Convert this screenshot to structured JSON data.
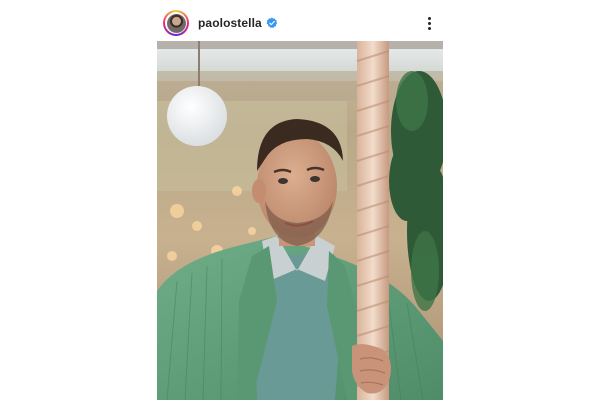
{
  "post": {
    "author": {
      "username": "paolostella",
      "verified": true,
      "avatar_icon": "avatar-icon",
      "verified_icon": "verified-badge-icon"
    },
    "menu_icon": "more-options-icon",
    "photo": {
      "subject": "man-portrait"
    }
  },
  "colors": {
    "text": "#262626",
    "verified_blue": "#3897f0",
    "jacket_green": "#5e9e78",
    "sweater_blue": "#6a9a96"
  }
}
